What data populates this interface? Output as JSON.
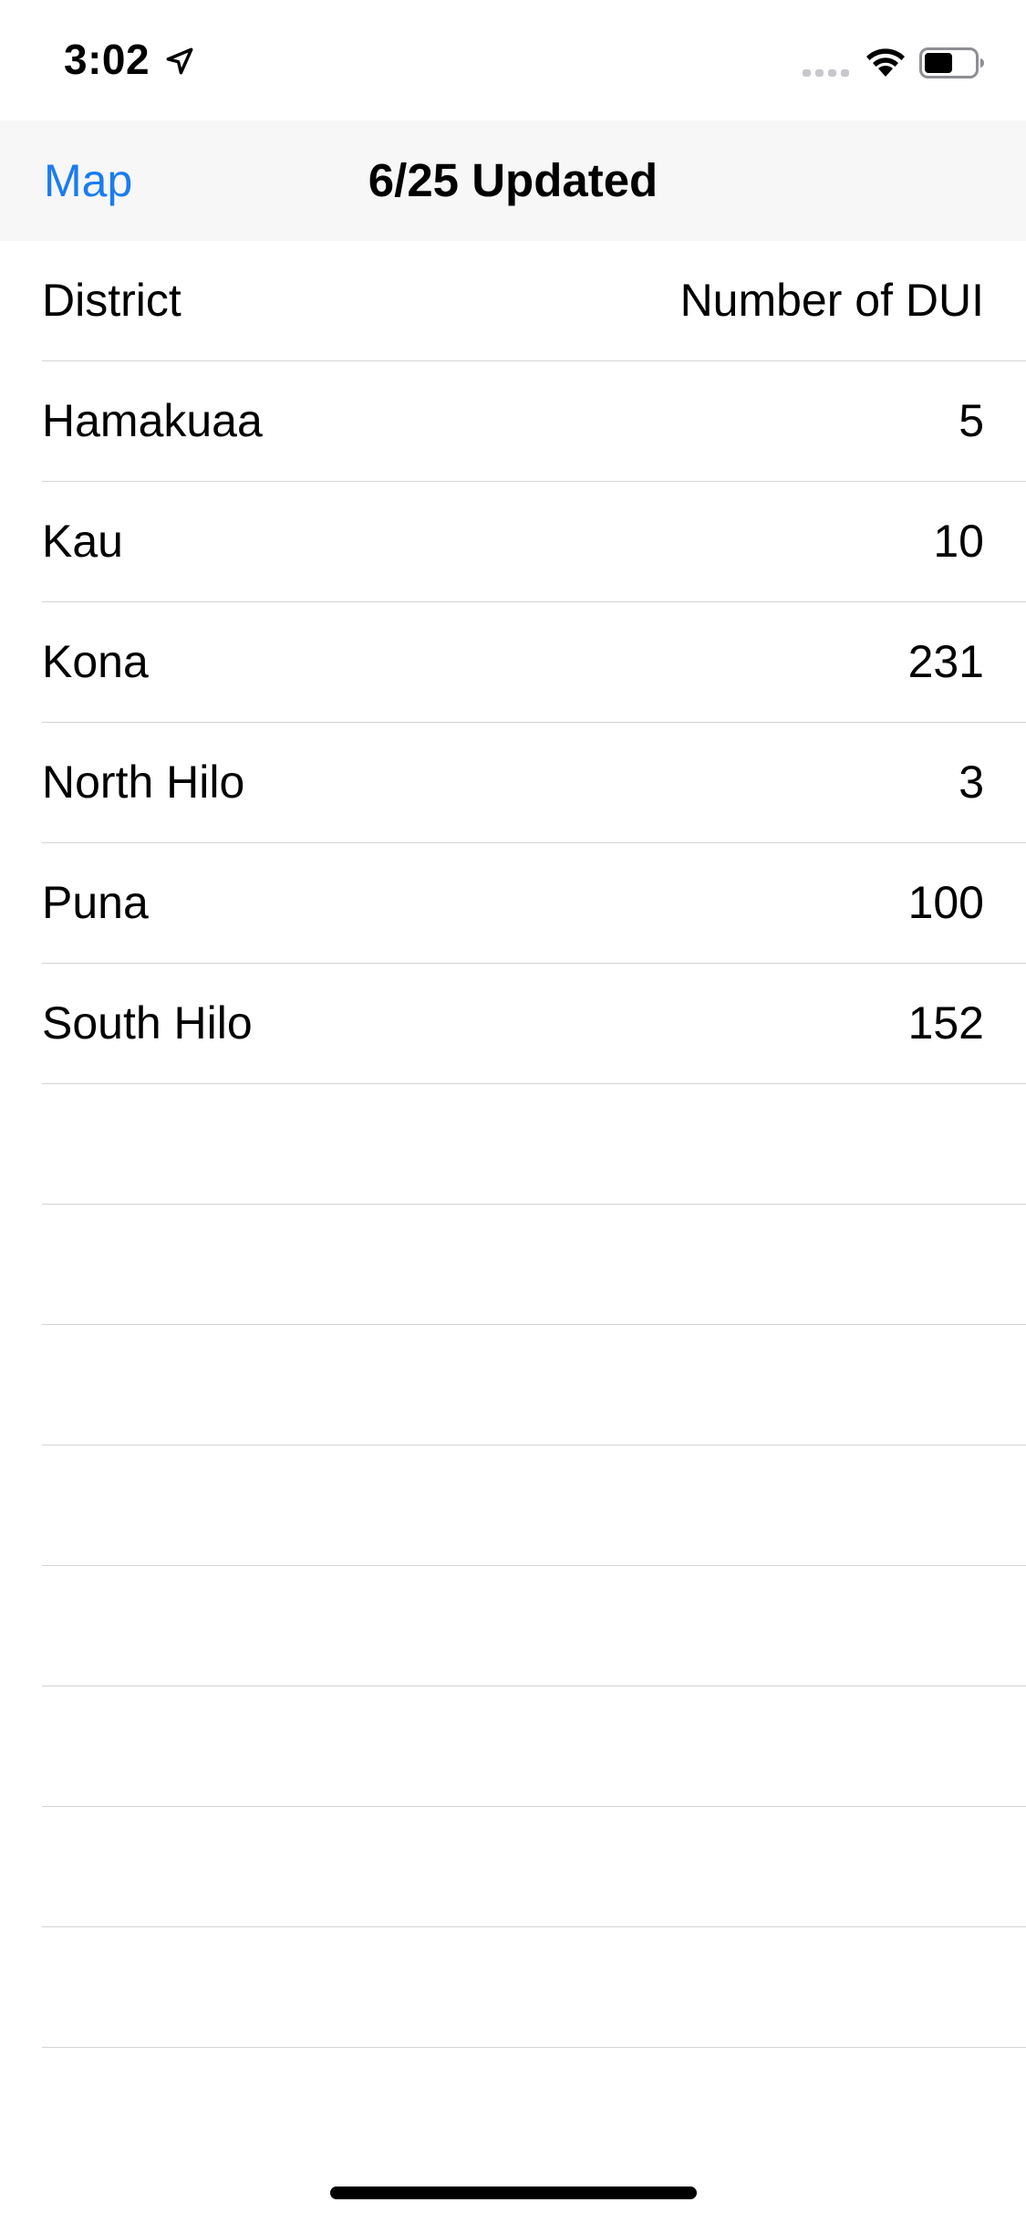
{
  "status_bar": {
    "time": "3:02"
  },
  "nav": {
    "back_label": "Map",
    "title": "6/25 Updated"
  },
  "table": {
    "header": {
      "left": "District",
      "right": "Number of DUI"
    },
    "rows": [
      {
        "district": "Hamakuaa",
        "count": "5"
      },
      {
        "district": "Kau",
        "count": "10"
      },
      {
        "district": "Kona",
        "count": "231"
      },
      {
        "district": "North Hilo",
        "count": "3"
      },
      {
        "district": "Puna",
        "count": "100"
      },
      {
        "district": "South Hilo",
        "count": "152"
      }
    ],
    "empty_rows": 8
  },
  "icons": {
    "location": "location-arrow-icon",
    "signal": "cellular-signal-icon",
    "wifi": "wifi-icon",
    "battery": "battery-icon"
  },
  "colors": {
    "accent": "#1a7cf0",
    "nav_background": "#f7f7f7",
    "separator": "#d4d4d6"
  }
}
